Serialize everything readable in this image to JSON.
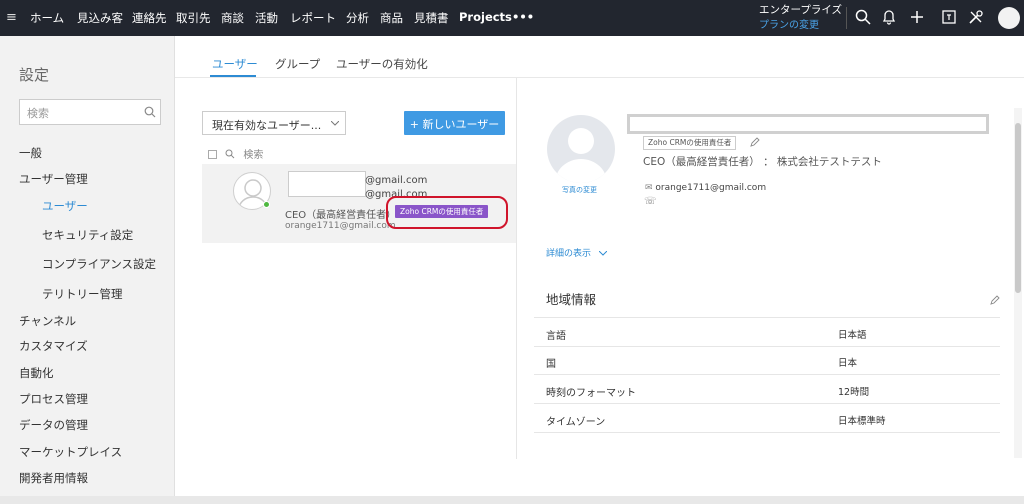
{
  "topbar": {
    "nav": [
      "ホーム",
      "見込み客",
      "連絡先",
      "取引先",
      "商談",
      "活動",
      "レポート",
      "分析",
      "商品",
      "見積書",
      "Projects",
      "•••"
    ],
    "edition": "エンタープライズ",
    "plan_link": "プランの変更"
  },
  "sidebar": {
    "title": "設定",
    "search_placeholder": "検索",
    "items": [
      {
        "label": "一般"
      },
      {
        "label": "ユーザー管理"
      },
      {
        "label": "ユーザー"
      },
      {
        "label": "セキュリティ設定"
      },
      {
        "label": "コンプライアンス設定"
      },
      {
        "label": "テリトリー管理"
      },
      {
        "label": "チャンネル"
      },
      {
        "label": "カスタマイズ"
      },
      {
        "label": "自動化"
      },
      {
        "label": "プロセス管理"
      },
      {
        "label": "データの管理"
      },
      {
        "label": "マーケットプレイス"
      },
      {
        "label": "開発者用情報"
      }
    ]
  },
  "tabs": [
    "ユーザー",
    "グループ",
    "ユーザーの有効化"
  ],
  "userlist": {
    "filter_value": "現在有効なユーザー...",
    "new_button": "+ 新しいユーザー",
    "search_label": "検索",
    "user": {
      "email_line1": "@gmail.com",
      "email_line2": "@gmail.com",
      "role": "CEO（最高経営責任者）",
      "badge": "Zoho CRMの使用責任者",
      "email": "orange1711@gmail.com"
    }
  },
  "details": {
    "photo_change": "写真の変更",
    "role_chip": "Zoho CRMの使用責任者",
    "role_line": "CEO（最高経営責任者） ： 株式会社テストテスト",
    "email": "orange1711@gmail.com",
    "more_link": "詳細の表示",
    "section_title": "地域情報",
    "rows": [
      {
        "label": "言語",
        "value": "日本語"
      },
      {
        "label": "国",
        "value": "日本"
      },
      {
        "label": "時刻のフォーマット",
        "value": "12時間"
      },
      {
        "label": "タイムゾーン",
        "value": "日本標準時"
      }
    ]
  },
  "colors": {
    "topbar": "#22262f",
    "accent": "#2d8bd3",
    "badge": "#8a55c9",
    "highlight": "#d0142b"
  }
}
